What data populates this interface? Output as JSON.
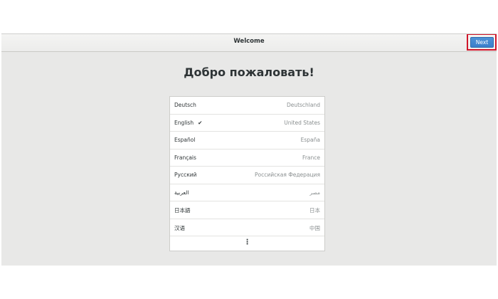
{
  "header": {
    "title": "Welcome",
    "next_label": "Next"
  },
  "main": {
    "heading": "Добро пожаловать!",
    "languages": [
      {
        "name": "Deutsch",
        "region": "Deutschland",
        "selected": false
      },
      {
        "name": "English",
        "region": "United States",
        "selected": true
      },
      {
        "name": "Español",
        "region": "España",
        "selected": false
      },
      {
        "name": "Français",
        "region": "France",
        "selected": false
      },
      {
        "name": "Русский",
        "region": "Российская Федерация",
        "selected": false
      },
      {
        "name": "العربية",
        "region": "مصر",
        "selected": false
      },
      {
        "name": "日本語",
        "region": "日本",
        "selected": false
      },
      {
        "name": "汉语",
        "region": "中国",
        "selected": false
      }
    ],
    "more_glyph": "⋮",
    "check_glyph": "✔"
  },
  "colors": {
    "accent": "#3b7fcb",
    "highlight": "#d0162b",
    "background": "#e8e8e7"
  }
}
